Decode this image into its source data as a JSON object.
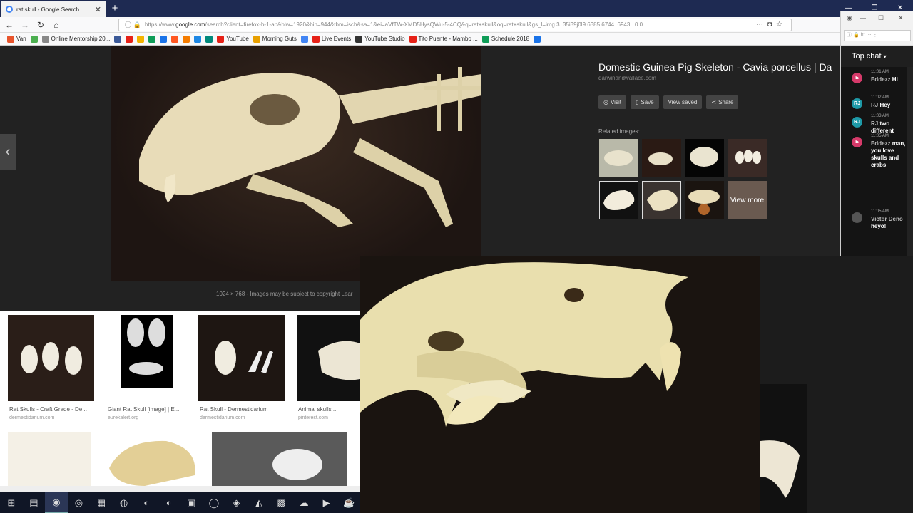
{
  "browser": {
    "tab_title": "rat skull - Google Search",
    "url_prefix": "https://www.",
    "url_domain": "google.com",
    "url_rest": "/search?client=firefox-b-1-ab&biw=1920&bih=944&tbm=isch&sa=1&ei=aVfTW-XMD5HysQWu-5-4CQ&q=rat+skull&oq=rat+skull&gs_l=img.3..35i39j0l9.6385.6744..6943...0.0..."
  },
  "bookmarks": [
    {
      "label": "Van",
      "color": "#e8542c"
    },
    {
      "label": "",
      "color": "#4caf50"
    },
    {
      "label": "Online Mentorship 20...",
      "color": "#888888"
    },
    {
      "label": "",
      "color": "#3b5998"
    },
    {
      "label": "",
      "color": "#e62117"
    },
    {
      "label": "",
      "color": "#f4b400"
    },
    {
      "label": "",
      "color": "#0f9d58"
    },
    {
      "label": "",
      "color": "#1a73e8"
    },
    {
      "label": "",
      "color": "#ff5722"
    },
    {
      "label": "",
      "color": "#f57c00"
    },
    {
      "label": "",
      "color": "#1e88e5"
    },
    {
      "label": "",
      "color": "#00897b"
    },
    {
      "label": "YouTube",
      "color": "#e62117"
    },
    {
      "label": "Morning Guts",
      "color": "#e8a000"
    },
    {
      "label": "",
      "color": "#4285f4"
    },
    {
      "label": "Live Events",
      "color": "#e62117"
    },
    {
      "label": "YouTube Studio",
      "color": "#333333"
    },
    {
      "label": "Tito Puente - Mambo ...",
      "color": "#e62117"
    },
    {
      "label": "Schedule 2018",
      "color": "#0f9d58"
    },
    {
      "label": "",
      "color": "#1a73e8"
    }
  ],
  "viewer": {
    "title": "Domestic Guinea Pig Skeleton - Cavia porcellus | Da",
    "source": "darwinandwallace.com",
    "dims_note": "1024 × 768  -  Images may be subject to copyright  Lear",
    "actions": [
      {
        "icon": "globe-icon",
        "glyph": "◎",
        "label": "Visit"
      },
      {
        "icon": "bookmark-icon",
        "glyph": "▯",
        "label": "Save"
      },
      {
        "icon": "",
        "glyph": "",
        "label": "View saved"
      },
      {
        "icon": "share-icon",
        "glyph": "⋖",
        "label": "Share"
      }
    ],
    "related_title": "Related images:",
    "view_more": "View more"
  },
  "results": [
    {
      "title": "Rat Skulls - Craft Grade - De...",
      "domain": "dermestidarium.com"
    },
    {
      "title": "Giant Rat Skull [image] | E...",
      "domain": "eurekalert.org"
    },
    {
      "title": "Rat Skull - Dermestidarium",
      "domain": "dermestidarium.com"
    },
    {
      "title": "Animal skulls ...",
      "domain": "pinterest.com"
    }
  ],
  "chat": {
    "header": "Top chat",
    "url_text": "ht",
    "messages": [
      {
        "avatar": "E",
        "color": "#d63a6a",
        "time": "11:01 AM",
        "author": "Eddezz",
        "text": "Hi"
      },
      {
        "avatar": "RJ",
        "color": "#1e9aa8",
        "time": "11:02 AM",
        "author": "RJ",
        "text": "Hey"
      },
      {
        "avatar": "RJ",
        "color": "#1e9aa8",
        "time": "11:03 AM",
        "author": "RJ",
        "text": "two different"
      },
      {
        "avatar": "E",
        "color": "#d63a6a",
        "time": "11:05 AM",
        "author": "Eddezz",
        "text": "man, you love skulls and crabs"
      },
      {
        "avatar": "",
        "color": "#555555",
        "time": "11:05 AM",
        "author": "Victor Deno",
        "text": "heyo!"
      }
    ]
  },
  "taskbar": {
    "icons": [
      "windows-icon",
      "file-explorer-icon",
      "firefox-icon",
      "davinci-icon",
      "notepad-icon",
      "obs-icon",
      "blender-icon",
      "blender-icon",
      "app-icon",
      "chrome-icon",
      "game-icon",
      "audio-icon",
      "network-icon",
      "soundcloud-icon",
      "video-icon",
      "cup-icon"
    ]
  }
}
